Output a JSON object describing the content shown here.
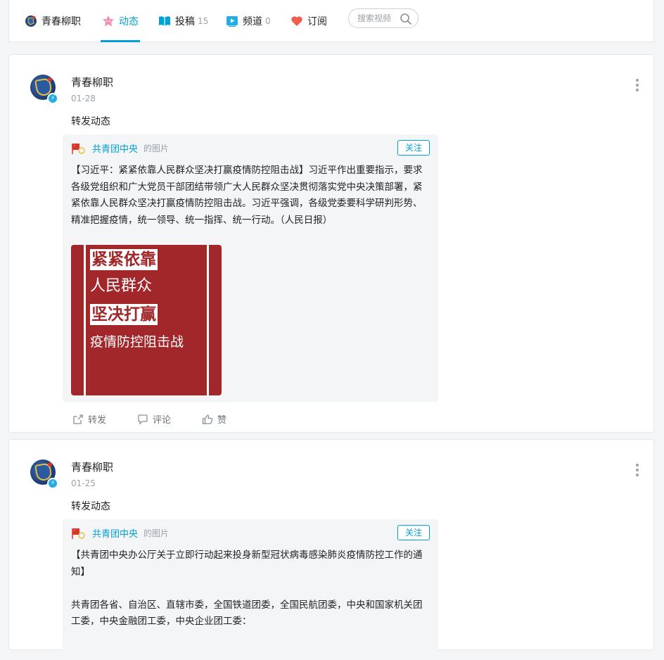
{
  "nav": {
    "user": "青春柳职",
    "tabs": [
      {
        "label": "动态",
        "count": ""
      },
      {
        "label": "投稿",
        "count": "15"
      },
      {
        "label": "频道",
        "count": "0"
      },
      {
        "label": "订阅",
        "count": ""
      }
    ],
    "search_placeholder": "搜索视频"
  },
  "posts": [
    {
      "author": "青春柳职",
      "date": "01-28",
      "desc": "转发动态",
      "repost": {
        "source": "共青团中央",
        "type": "的图片",
        "follow": "关注",
        "text": "【习近平：紧紧依靠人民群众坚决打赢疫情防控阻击战】习近平作出重要指示，要求各级党组织和广大党员干部团结带领广大人民群众坚决贯彻落实党中央决策部署，紧紧依靠人民群众坚决打赢疫情防控阻击战。习近平强调，各级党委要科学研判形势、精准把握疫情，统一领导、统一指挥、统一行动。（人民日报）",
        "poster": {
          "line1": "紧紧依靠",
          "line2": "人民群众",
          "line3": "坚决打赢",
          "line4": "疫情防控阻击战"
        }
      },
      "actions": {
        "repost": "转发",
        "comment": "评论",
        "like": "赞"
      }
    },
    {
      "author": "青春柳职",
      "date": "01-25",
      "desc": "转发动态",
      "repost": {
        "source": "共青团中央",
        "type": "的图片",
        "follow": "关注",
        "text": "【共青团中央办公厅关于立即行动起来投身新型冠状病毒感染肺炎疫情防控工作的通知】\n\n共青团各省、自治区、直辖市委，全国铁道团委，全国民航团委，中央和国家机关团工委，中央金融团工委，中央企业团工委："
      }
    }
  ],
  "colors": {
    "accent": "#00a1d6",
    "poster_red": "#a1272a",
    "like_red": "#f25d4e"
  }
}
